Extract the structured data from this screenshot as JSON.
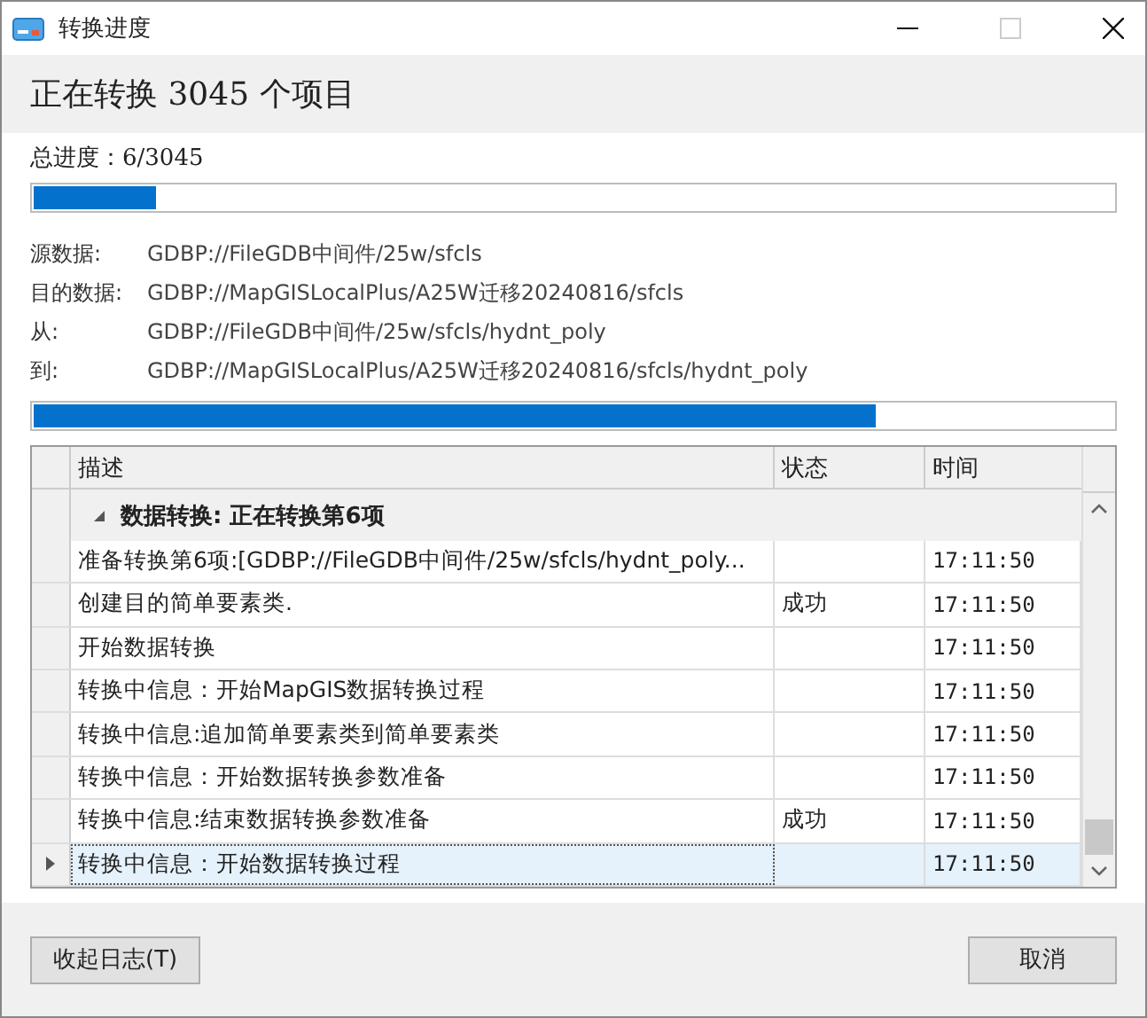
{
  "window": {
    "title": "转换进度"
  },
  "header": "正在转换 3045 个项目",
  "total_progress": {
    "label": "总进度：6/3045",
    "level": 0.113
  },
  "details": [
    {
      "label": "源数据:",
      "value": "GDBP://FileGDB中间件/25w/sfcls"
    },
    {
      "label": "目的数据:",
      "value": "GDBP://MapGISLocalPlus/A25W迁移20240816/sfcls"
    },
    {
      "label": "从:",
      "value": "GDBP://FileGDB中间件/25w/sfcls/hydnt_poly"
    },
    {
      "label": "到:",
      "value": "GDBP://MapGISLocalPlus/A25W迁移20240816/sfcls/hydnt_poly"
    }
  ],
  "item_progress": {
    "level": 0.78
  },
  "table": {
    "columns": [
      "描述",
      "状态",
      "时间"
    ],
    "group": {
      "label": "数据转换: 正在转换第6项",
      "expanded": true
    },
    "rows": [
      {
        "description": "准备转换第6项:[GDBP://FileGDB中间件/25w/sfcls/hydnt_poly...",
        "status": "",
        "time": "17:11:50",
        "selected": false
      },
      {
        "description": "创建目的简单要素类.",
        "status": "成功",
        "time": "17:11:50",
        "selected": false
      },
      {
        "description": "开始数据转换",
        "status": "",
        "time": "17:11:50",
        "selected": false
      },
      {
        "description": "转换中信息：开始MapGIS数据转换过程",
        "status": "",
        "time": "17:11:50",
        "selected": false
      },
      {
        "description": "转换中信息:追加简单要素类到简单要素类",
        "status": "",
        "time": "17:11:50",
        "selected": false
      },
      {
        "description": "转换中信息：开始数据转换参数准备",
        "status": "",
        "time": "17:11:50",
        "selected": false
      },
      {
        "description": "转换中信息:结束数据转换参数准备",
        "status": "成功",
        "time": "17:11:50",
        "selected": false
      },
      {
        "description": "转换中信息：开始数据转换过程",
        "status": "",
        "time": "17:11:50",
        "selected": true
      }
    ]
  },
  "buttons": [
    "收起日志(T)",
    "取消"
  ]
}
